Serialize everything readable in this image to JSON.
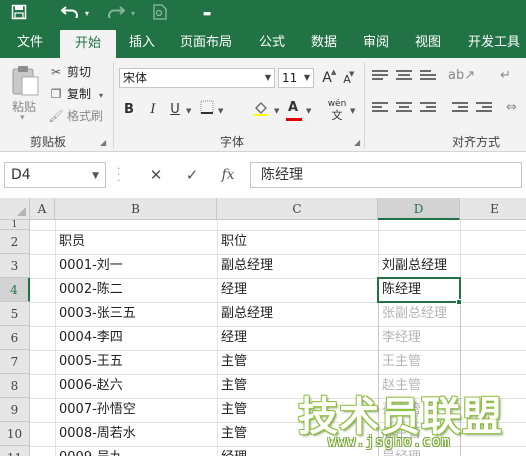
{
  "title_bar": {
    "save_icon": "save-icon",
    "undo_icon": "undo-icon",
    "redo_icon": "redo-icon",
    "preview_icon": "print-preview-icon",
    "customize_icon": "customize-qat-icon"
  },
  "tabs": [
    "文件",
    "开始",
    "插入",
    "页面布局",
    "公式",
    "数据",
    "审阅",
    "视图",
    "开发工具"
  ],
  "active_tab": "开始",
  "ribbon": {
    "clipboard": {
      "paste_label": "粘贴",
      "cut_label": "剪切",
      "copy_label": "复制",
      "format_painter_label": "格式刷",
      "group_label": "剪贴板"
    },
    "font": {
      "font_name": "宋体",
      "font_size": "11",
      "grow_label": "A",
      "shrink_label": "A",
      "bold_label": "B",
      "italic_label": "I",
      "underline_label": "U",
      "font_color_label": "A",
      "phonetic_label": "wén",
      "group_label": "字体"
    },
    "alignment": {
      "group_label": "对齐方式"
    }
  },
  "formula_bar": {
    "name_box": "D4",
    "cancel_symbol": "✕",
    "enter_symbol": "✓",
    "fx_label": "fx",
    "formula": "陈经理"
  },
  "sheet": {
    "columns": [
      "A",
      "B",
      "C",
      "D",
      "E"
    ],
    "rows": [
      "1",
      "2",
      "3",
      "4",
      "5",
      "6",
      "7",
      "8",
      "9",
      "10",
      "11"
    ],
    "active_column": "D",
    "active_row": "4",
    "cells": {
      "B2": "职员",
      "C2": "职位",
      "B3": "0001-刘一",
      "C3": "副总经理",
      "D3": "刘副总经理",
      "B4": "0002-陈二",
      "C4": "经理",
      "D4": "陈经理",
      "B5": "0003-张三五",
      "C5": "副总经理",
      "B6": "0004-李四",
      "C6": "经理",
      "B7": "0005-王五",
      "C7": "主管",
      "B8": "0006-赵六",
      "C8": "主管",
      "B9": "0007-孙悟空",
      "C9": "主管",
      "B10": "0008-周若水",
      "C10": "主管",
      "B11": "0009-吴九",
      "C11": "经理"
    },
    "flash_fill_preview": {
      "D5": "张副总经理",
      "D6": "李经理",
      "D7": "王主管",
      "D8": "赵主管",
      "D9": "孙主管",
      "D10": "周主管",
      "D11": "吴经理"
    }
  },
  "watermark": {
    "logo_text": "技术员联盟",
    "url": "www.jsgho.com"
  },
  "colors": {
    "excel_green": "#217346",
    "ribbon_bg": "#f3f3f3",
    "header_bg": "#e6e6e6",
    "ghost_text": "#b5b5b5"
  }
}
